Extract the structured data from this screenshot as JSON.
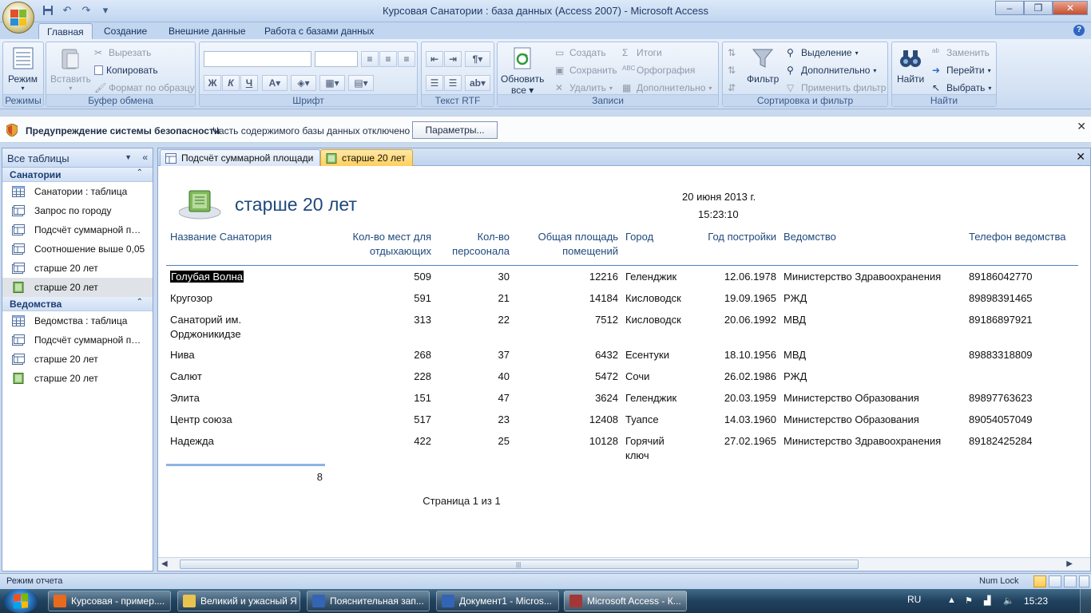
{
  "window": {
    "title": "Курсовая Санатории : база данных (Access 2007) - Microsoft Access",
    "minimize_glyph": "–",
    "maximize_glyph": "❐",
    "close_glyph": "✕"
  },
  "qat": [
    "save-icon",
    "undo-icon",
    "redo-icon",
    "customize-icon"
  ],
  "ribbon_tabs": [
    {
      "label": "Главная",
      "active": true
    },
    {
      "label": "Создание"
    },
    {
      "label": "Внешние данные"
    },
    {
      "label": "Работа с базами данных"
    }
  ],
  "ribbon": {
    "modes": {
      "label": "Режимы",
      "view_label": "Режим"
    },
    "clipboard": {
      "label": "Буфер обмена",
      "paste_label": "Вставить",
      "cut_label": "Вырезать",
      "copy_label": "Копировать",
      "format_painter_label": "Формат по образцу"
    },
    "font": {
      "label": "Шрифт",
      "bold": "Ж",
      "italic": "К",
      "underline": "Ч"
    },
    "rich_text": {
      "label": "Текст RTF"
    },
    "records": {
      "label": "Записи",
      "refresh_label": "Обновить",
      "refresh_label2": "все",
      "new_label": "Создать",
      "save_label": "Сохранить",
      "delete_label": "Удалить",
      "totals_label": "Итоги",
      "spelling_label": "Орфография",
      "more_label": "Дополнительно"
    },
    "sort_filter": {
      "label": "Сортировка и фильтр",
      "filter_label": "Фильтр",
      "selection_label": "Выделение",
      "advanced_label": "Дополнительно",
      "toggle_filter_label": "Применить фильтр"
    },
    "find": {
      "label": "Найти",
      "find_label": "Найти",
      "replace_label": "Заменить",
      "goto_label": "Перейти",
      "select_label": "Выбрать"
    }
  },
  "security_bar": {
    "title": "Предупреждение системы безопасности",
    "message": "Часть содержимого базы данных отключено",
    "button_label": "Параметры...",
    "close_glyph": "✕"
  },
  "nav": {
    "header": "Все таблицы",
    "groups": [
      {
        "label": "Санатории",
        "items": [
          {
            "label": "Санатории : таблица",
            "icon": "table-icon"
          },
          {
            "label": "Запрос по городу",
            "icon": "query-icon"
          },
          {
            "label": "Подсчёт суммарной пло...",
            "icon": "query-icon"
          },
          {
            "label": "Соотношение выше 0,05",
            "icon": "query-icon"
          },
          {
            "label": "старше 20 лет",
            "icon": "query-icon"
          },
          {
            "label": "старше 20 лет",
            "icon": "report-icon",
            "selected": true
          }
        ]
      },
      {
        "label": "Ведомства",
        "items": [
          {
            "label": "Ведомства : таблица",
            "icon": "table-icon"
          },
          {
            "label": "Подсчёт суммарной пло...",
            "icon": "query-icon"
          },
          {
            "label": "старше 20 лет",
            "icon": "query-icon"
          },
          {
            "label": "старше 20 лет",
            "icon": "report-icon"
          }
        ]
      }
    ]
  },
  "doc_tabs": [
    {
      "label": "Подсчёт суммарной площади",
      "icon": "query-icon"
    },
    {
      "label": "старше 20 лет",
      "icon": "report-icon",
      "active": true
    }
  ],
  "doc_close_glyph": "✕",
  "report": {
    "title": "старше 20 лет",
    "date": "20 июня 2013 г.",
    "time": "15:23:10",
    "headers": {
      "name": "Название Санатория",
      "places": [
        "Кол-во мест для",
        "отдыхающих"
      ],
      "staff": [
        "Кол-во",
        "персоонала"
      ],
      "area": [
        "Общая площадь",
        "помещений"
      ],
      "city": "Город",
      "year": "Год постройки",
      "dept": "Ведомство",
      "phone": "Телефон ведомства"
    },
    "rows": [
      {
        "name": [
          "Голубая Волна"
        ],
        "places": "509",
        "staff": "30",
        "area": "12216",
        "city": [
          "Геленджик"
        ],
        "year": "12.06.1978",
        "dept": "Министерство Здравоохранения",
        "phone": "89186042770",
        "selected": true
      },
      {
        "name": [
          "Кругозор"
        ],
        "places": "591",
        "staff": "21",
        "area": "14184",
        "city": [
          "Кисловодск"
        ],
        "year": "19.09.1965",
        "dept": "РЖД",
        "phone": "89898391465"
      },
      {
        "name": [
          "Санаторий им.",
          "Орджоникидзе"
        ],
        "places": "313",
        "staff": "22",
        "area": "7512",
        "city": [
          "Кисловодск"
        ],
        "year": "20.06.1992",
        "dept": "МВД",
        "phone": "89186897921"
      },
      {
        "name": [
          "Нива"
        ],
        "places": "268",
        "staff": "37",
        "area": "6432",
        "city": [
          "Есентуки"
        ],
        "year": "18.10.1956",
        "dept": "МВД",
        "phone": "89883318809"
      },
      {
        "name": [
          "Салют"
        ],
        "places": "228",
        "staff": "40",
        "area": "5472",
        "city": [
          "Сочи"
        ],
        "year": "26.02.1986",
        "dept": "РЖД",
        "phone": ""
      },
      {
        "name": [
          "Элита"
        ],
        "places": "151",
        "staff": "47",
        "area": "3624",
        "city": [
          "Геленджик"
        ],
        "year": "20.03.1959",
        "dept": "Министерство Образования",
        "phone": "89897763623"
      },
      {
        "name": [
          "Центр союза"
        ],
        "places": "517",
        "staff": "23",
        "area": "12408",
        "city": [
          "Туапсе"
        ],
        "year": "14.03.1960",
        "dept": "Министерство Образования",
        "phone": "89054057049"
      },
      {
        "name": [
          "Надежда"
        ],
        "places": "422",
        "staff": "25",
        "area": "10128",
        "city": [
          "Горячий",
          "ключ"
        ],
        "year": "27.02.1965",
        "dept": "Министерство Здравоохранения",
        "phone": "89182425284"
      }
    ],
    "count": "8",
    "page": "Страница 1 из 1"
  },
  "status": {
    "text": "Режим отчета",
    "numlock": "Num Lock"
  },
  "taskbar": {
    "items": [
      {
        "label": "Курсовая - пример....",
        "icon": "firefox-icon",
        "color": "#e86a1c"
      },
      {
        "label": "Великий и ужасный Я",
        "icon": "folder-icon",
        "color": "#e9c350"
      },
      {
        "label": "Пояснительная зап...",
        "icon": "word-icon",
        "color": "#3464b4"
      },
      {
        "label": "Документ1 - Micros...",
        "icon": "word-icon",
        "color": "#3464b4"
      },
      {
        "label": "Microsoft Access - К...",
        "icon": "access-icon",
        "color": "#a33737",
        "active": true
      }
    ],
    "lang": "RU",
    "clock": "15:23"
  }
}
